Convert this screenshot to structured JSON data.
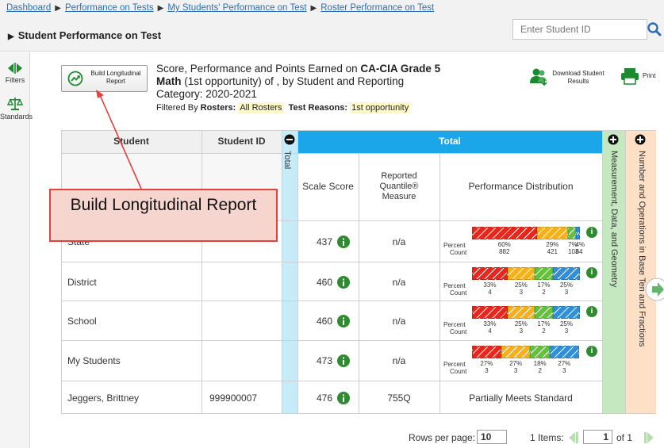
{
  "breadcrumb": {
    "items": [
      "Dashboard",
      "Performance on Tests",
      "My Students' Performance on Test",
      "Roster Performance on Test"
    ]
  },
  "page_title": "Student Performance on Test",
  "search": {
    "placeholder": "Enter Student ID"
  },
  "leftrail": {
    "filters_label": "Filters",
    "standards_label": "Standards"
  },
  "toolbar": {
    "build_label": "Build Longitudinal Report",
    "download_label": "Download Student Results",
    "print_label": "Print"
  },
  "report": {
    "title_prefix": "Score, Performance and Points Earned on ",
    "title_bold_test": "CA-CIA Grade 5",
    "title_bold_subject": "Math",
    "title_suffix": " (1st opportunity) of , by Student and Reporting",
    "category_line": "Category: 2020-2021",
    "filtered_by_label": "Filtered By ",
    "rosters_label": "Rosters:",
    "rosters_value": "All Rosters",
    "reasons_label": "Test Reasons:",
    "reasons_value": "1st opportunity"
  },
  "table": {
    "headers": {
      "student": "Student",
      "student_id": "Student ID",
      "total_collapsed": "Total",
      "total_group": "Total",
      "scale_score": "Scale Score",
      "quantile": "Reported Quantile® Measure",
      "perf_dist": "Performance Distribution",
      "claim1": "Measurement, Data, and Geometry",
      "claim2": "Number and Operations in Base Ten and Fractions"
    },
    "percent_label": "Percent",
    "count_label": "Count",
    "rows": [
      {
        "student": "State",
        "student_id": "",
        "score": "437",
        "quantile": "n/a",
        "percents": [
          "60%",
          "29%",
          "7%",
          "4%"
        ],
        "counts": [
          "882",
          "421",
          "103",
          "64"
        ],
        "fractions": [
          0.6,
          0.29,
          0.07,
          0.04
        ]
      },
      {
        "student": "District",
        "student_id": "",
        "score": "460",
        "quantile": "n/a",
        "percents": [
          "33%",
          "25%",
          "17%",
          "25%"
        ],
        "counts": [
          "4",
          "3",
          "2",
          "3"
        ],
        "fractions": [
          0.33,
          0.25,
          0.17,
          0.25
        ]
      },
      {
        "student": "School",
        "student_id": "",
        "score": "460",
        "quantile": "n/a",
        "percents": [
          "33%",
          "25%",
          "17%",
          "25%"
        ],
        "counts": [
          "4",
          "3",
          "2",
          "3"
        ],
        "fractions": [
          0.33,
          0.25,
          0.17,
          0.25
        ]
      },
      {
        "student": "My Students",
        "student_id": "",
        "score": "473",
        "quantile": "n/a",
        "percents": [
          "27%",
          "27%",
          "18%",
          "27%"
        ],
        "counts": [
          "3",
          "3",
          "2",
          "3"
        ],
        "fractions": [
          0.27,
          0.27,
          0.18,
          0.27
        ]
      },
      {
        "student": "Jeggers, Brittney",
        "student_id": "999900007",
        "score": "476",
        "quantile": "755Q",
        "level": "Partially Meets Standard"
      }
    ]
  },
  "pagination": {
    "rows_per_page_label": "Rows per page:",
    "rows_per_page_value": "10",
    "items_label": "1 Items:",
    "page_value": "1",
    "of_label": "of 1"
  },
  "callout": {
    "text": "Build Longitudinal Report"
  },
  "colors": {
    "level1": "#e8261c",
    "level2": "#f7b01a",
    "level3": "#63c23b",
    "level4": "#2f8fd8",
    "accent_blue": "#1aa6e8",
    "info_green": "#2e8b2e",
    "claim1_bg": "#c5e8c1",
    "claim2_bg": "#fde0c6"
  }
}
